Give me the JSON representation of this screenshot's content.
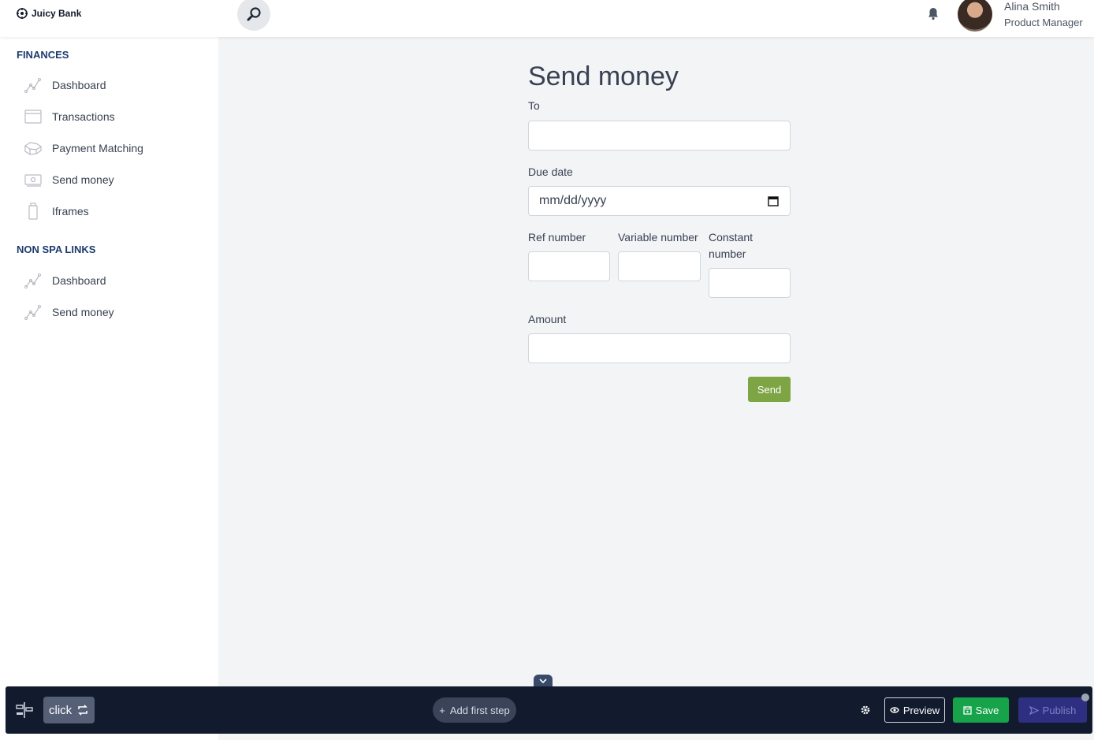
{
  "header": {
    "brand": "Juicy Bank",
    "user_name": "Alina Smith",
    "user_role": "Product Manager"
  },
  "sidebar": {
    "sections": [
      {
        "title": "FINANCES",
        "items": [
          {
            "label": "Dashboard",
            "icon": "chart-line-icon"
          },
          {
            "label": "Transactions",
            "icon": "window-icon"
          },
          {
            "label": "Payment Matching",
            "icon": "boxes-icon"
          },
          {
            "label": "Send money",
            "icon": "money-bill-icon"
          },
          {
            "label": "Iframes",
            "icon": "bottle-icon"
          }
        ]
      },
      {
        "title": "NON SPA LINKS",
        "items": [
          {
            "label": "Dashboard",
            "icon": "chart-line-icon"
          },
          {
            "label": "Send money",
            "icon": "chart-line-icon"
          }
        ]
      }
    ]
  },
  "form": {
    "title": "Send money",
    "to_label": "To",
    "to_value": "",
    "due_date_label": "Due date",
    "due_date_placeholder": "mm/dd/yyyy",
    "ref_label": "Ref number",
    "variable_label": "Variable number",
    "constant_label_1": "Constant",
    "constant_label_2": "number",
    "amount_label": "Amount",
    "send_label": "Send"
  },
  "toolbar": {
    "click_label": "click",
    "add_step_label": "Add first step",
    "preview_label": "Preview",
    "save_label": "Save",
    "publish_label": "Publish"
  },
  "colors": {
    "brand_navy": "#1e3a6e",
    "send_green": "#7da544",
    "save_green": "#16a34a",
    "publish_indigo": "#2f2f82",
    "toolbar_bg": "#121a2e"
  }
}
